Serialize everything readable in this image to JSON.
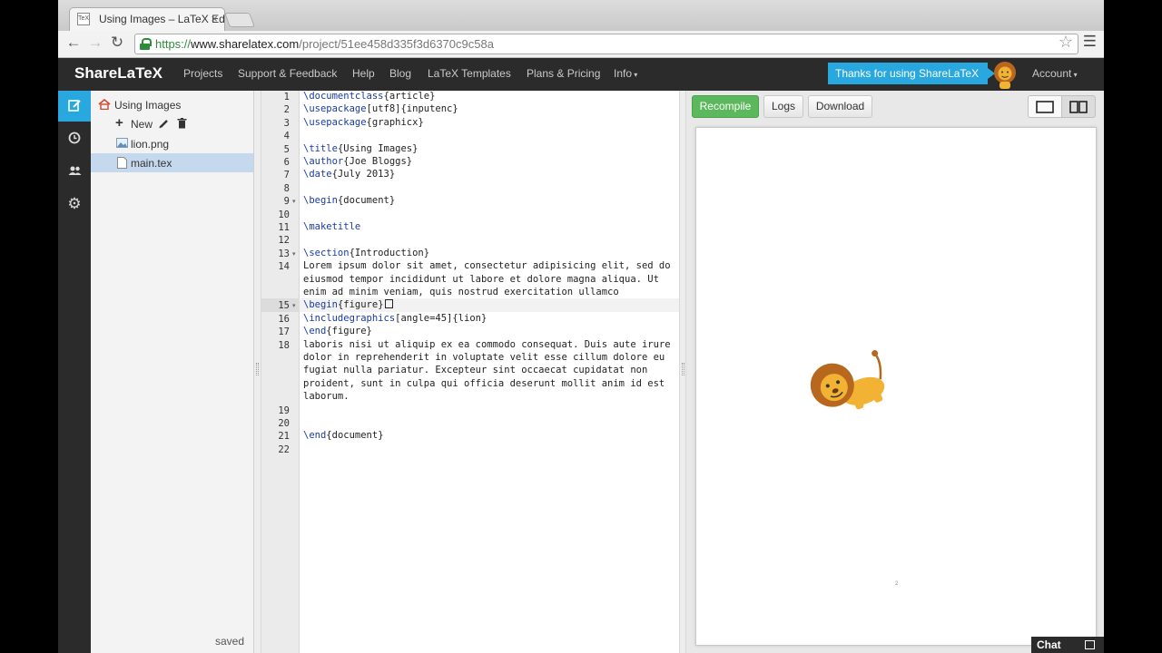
{
  "browser": {
    "tab_title": "Using Images – LaTeX Edit",
    "url_scheme": "https://",
    "url_host": "www.sharelatex.com",
    "url_path": "/project/51ee458d335f3d6370c9c58a"
  },
  "nav": {
    "brand": "ShareLaTeX",
    "links": [
      "Projects",
      "Support & Feedback",
      "Help",
      "Blog",
      "LaTeX Templates",
      "Plans & Pricing",
      "Info"
    ],
    "thanks": "Thanks for using ShareLaTeX",
    "account": "Account"
  },
  "tree": {
    "project": "Using Images",
    "new_label": "New",
    "files": [
      "lion.png",
      "main.tex"
    ],
    "selected": "main.tex",
    "status": "saved"
  },
  "editor": {
    "line_numbers": [
      "1",
      "2",
      "3",
      "4",
      "5",
      "6",
      "7",
      "8",
      "9",
      "10",
      "11",
      "12",
      "13",
      "14",
      "",
      "",
      "15",
      "16",
      "17",
      "18",
      "",
      "",
      "",
      "",
      "19",
      "20",
      "21",
      "22"
    ],
    "fold_lines": [
      "9",
      "13",
      "15"
    ],
    "active_line": "15"
  },
  "pdf": {
    "recompile": "Recompile",
    "logs": "Logs",
    "download": "Download",
    "page_number": "2",
    "chat": "Chat"
  },
  "colors": {
    "accent": "#29a8df",
    "recompile": "#5cb85c",
    "navbar": "#2b2b2b",
    "keyword": "#1a3aa6"
  }
}
